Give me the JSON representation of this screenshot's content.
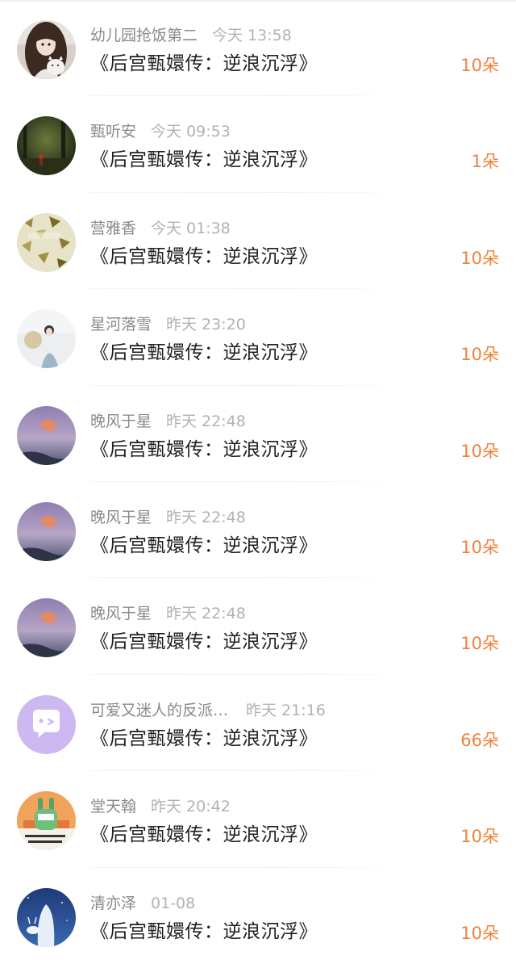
{
  "items": [
    {
      "name": "幼儿园抢饭第二",
      "time": "今天 13:58",
      "title": "《后宫甄嬛传：逆浪沉浮》",
      "gift": "10朵",
      "avatar": "avatar-girl-with-cat-icon"
    },
    {
      "name": "甄听安",
      "time": "今天 09:53",
      "title": "《后宫甄嬛传：逆浪沉浮》",
      "gift": "1朵",
      "avatar": "avatar-forest-figure-icon"
    },
    {
      "name": "营雅香",
      "time": "今天 01:38",
      "title": "《后宫甄嬛传：逆浪沉浮》",
      "gift": "10朵",
      "avatar": "avatar-leaves-icon"
    },
    {
      "name": "星河落雪",
      "time": "昨天 23:20",
      "title": "《后宫甄嬛传：逆浪沉浮》",
      "gift": "10朵",
      "avatar": "avatar-woman-with-fan-icon"
    },
    {
      "name": "晚风于星",
      "time": "昨天 22:48",
      "title": "《后宫甄嬛传：逆浪沉浮》",
      "gift": "10朵",
      "avatar": "avatar-sunset-sky-icon"
    },
    {
      "name": "晚风于星",
      "time": "昨天 22:48",
      "title": "《后宫甄嬛传：逆浪沉浮》",
      "gift": "10朵",
      "avatar": "avatar-sunset-sky-icon"
    },
    {
      "name": "晚风于星",
      "time": "昨天 22:48",
      "title": "《后宫甄嬛传：逆浪沉浮》",
      "gift": "10朵",
      "avatar": "avatar-sunset-sky-icon"
    },
    {
      "name": "可爱又迷人的反派…",
      "time": "昨天 21:16",
      "title": "《后宫甄嬛传：逆浪沉浮》",
      "gift": "66朵",
      "avatar": "avatar-default-chat-icon"
    },
    {
      "name": "堂天翰",
      "time": "昨天 20:42",
      "title": "《后宫甄嬛传：逆浪沉浮》",
      "gift": "10朵",
      "avatar": "avatar-cartoon-rabbit-icon"
    },
    {
      "name": "清亦泽",
      "time": "01-08",
      "title": "《后宫甄嬛传：逆浪沉浮》",
      "gift": "10朵",
      "avatar": "avatar-white-deer-icon"
    }
  ],
  "colors": {
    "gift": "#f2813a",
    "name": "#8a8a8a",
    "time": "#b2b2b2",
    "title": "#1f1f1f",
    "default_avatar": "#c9b3f0"
  }
}
